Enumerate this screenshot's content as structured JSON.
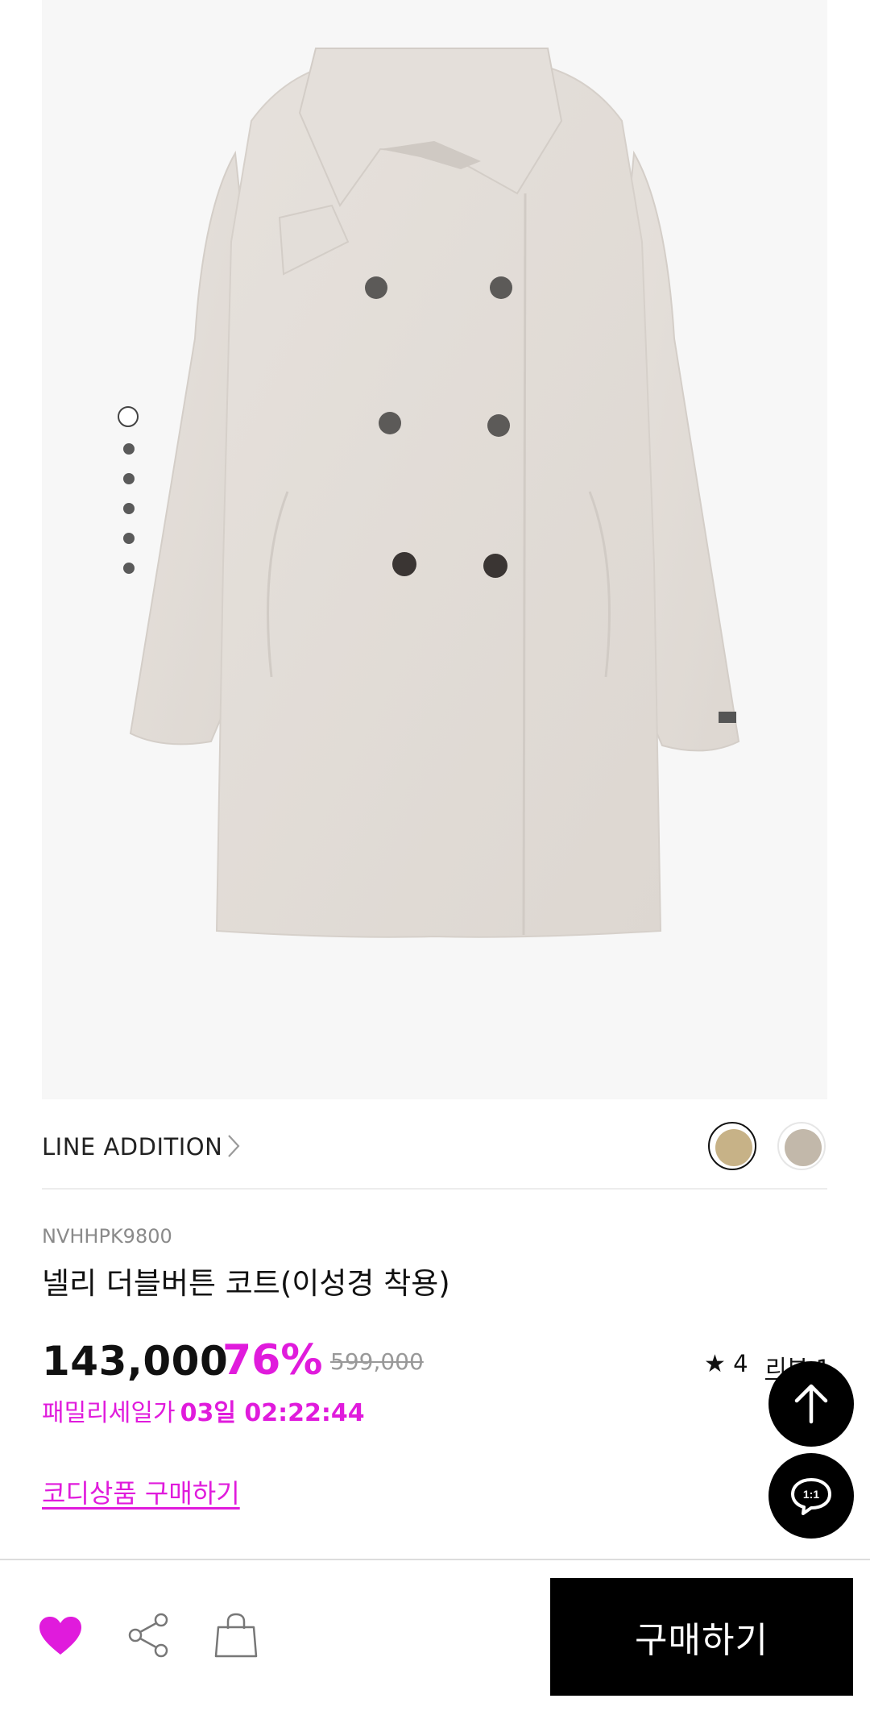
{
  "gallery": {
    "page_count": 6,
    "active_index": 0
  },
  "brand": {
    "name": "LINE ADDITION",
    "chevron_icon": "chevron-right-icon"
  },
  "swatches": [
    {
      "color": "#c7b287",
      "selected": true
    },
    {
      "color": "#c2b8aa",
      "selected": false
    }
  ],
  "product": {
    "sku": "NVHHPK9800",
    "title": "넬리 더블버튼 코트(이성경 착용)",
    "price": "143,000",
    "discount": "76%",
    "original_price": "599,000",
    "family_sale_label": "패밀리세일가",
    "family_sale_timer": "03일 02:22:44",
    "coordi_link": "코디상품 구매하기"
  },
  "rating": {
    "star_icon": "star-icon",
    "score": "4",
    "review_label": "리뷰 1"
  },
  "fabs": {
    "top_icon": "arrow-up-icon",
    "chat_icon": "chat-1to1-icon",
    "chat_text": "1:1"
  },
  "bottom_bar": {
    "wish_icon": "heart-icon",
    "share_icon": "share-icon",
    "cart_icon": "shopping-bag-icon",
    "buy_label": "구매하기"
  },
  "colors": {
    "accent": "#e01bdc",
    "primary_button": "#000000",
    "image_bg": "#f7f7f7"
  }
}
